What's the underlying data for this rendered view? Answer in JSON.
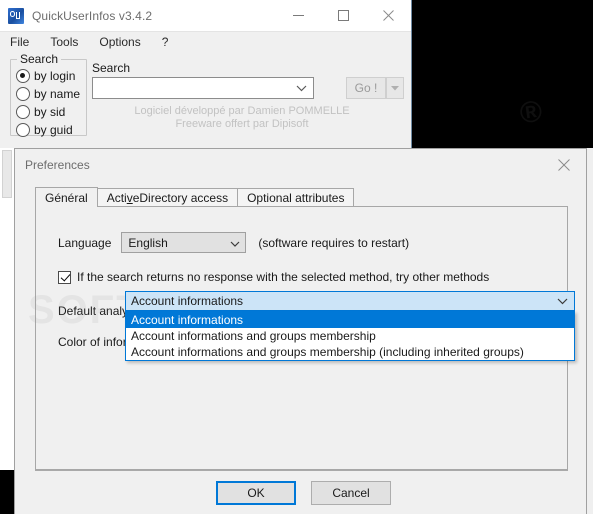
{
  "app_window": {
    "title": "QuickUserInfos v3.4.2",
    "icon": "app-icon",
    "window_controls": {
      "minimize": "minimize-icon",
      "maximize": "maximize-icon",
      "close": "close-icon"
    },
    "menu": [
      "File",
      "Tools",
      "Options",
      "?"
    ],
    "search_group": {
      "title": "Search",
      "options": [
        {
          "label": "by login",
          "selected": true
        },
        {
          "label": "by name",
          "selected": false
        },
        {
          "label": "by sid",
          "selected": false
        },
        {
          "label": "by guid",
          "selected": false
        }
      ]
    },
    "search_field": {
      "label": "Search",
      "value": "",
      "placeholder": ""
    },
    "go_button": {
      "label": "Go !",
      "enabled": false
    },
    "credits": {
      "line1": "Logiciel développé par Damien POMMELLE",
      "line2": "Freeware offert par Dipisoft"
    }
  },
  "preferences_dialog": {
    "title": "Preferences",
    "close": "close-icon",
    "tabs": [
      {
        "label": "Général",
        "active": true
      },
      {
        "label": "ActiveDirectory access",
        "active": false,
        "accel_prefix": "Acti",
        "accel_char": "v",
        "accel_suffix": "eDirectory access"
      },
      {
        "label": "Optional attributes",
        "active": false
      }
    ],
    "general": {
      "language_label": "Language",
      "language_value": "English",
      "language_hint": "(software requires to restart)",
      "fallback_checkbox": {
        "label": "If the search returns no response with the selected method, try other methods",
        "checked": true
      },
      "default_analysis_label": "Default analysis",
      "default_analysis_value": "Account informations",
      "default_analysis_options": [
        {
          "label": "Account informations",
          "selected": true
        },
        {
          "label": "Account informations and groups membership",
          "selected": false
        },
        {
          "label": "Account informations and groups membership (including inherited groups)",
          "selected": false
        }
      ],
      "color_label": "Color of informati"
    },
    "footer": {
      "ok_label": "OK",
      "cancel_label": "Cancel"
    }
  },
  "watermark": {
    "text": "SOFTPEDIA",
    "corner": "®"
  },
  "colors": {
    "accent": "#0078d7",
    "window_bg": "#f0f0f0",
    "field_focus_bg": "#cce4f7",
    "title_text": "#6d6d6d",
    "credits_text": "#c2c2c2"
  }
}
